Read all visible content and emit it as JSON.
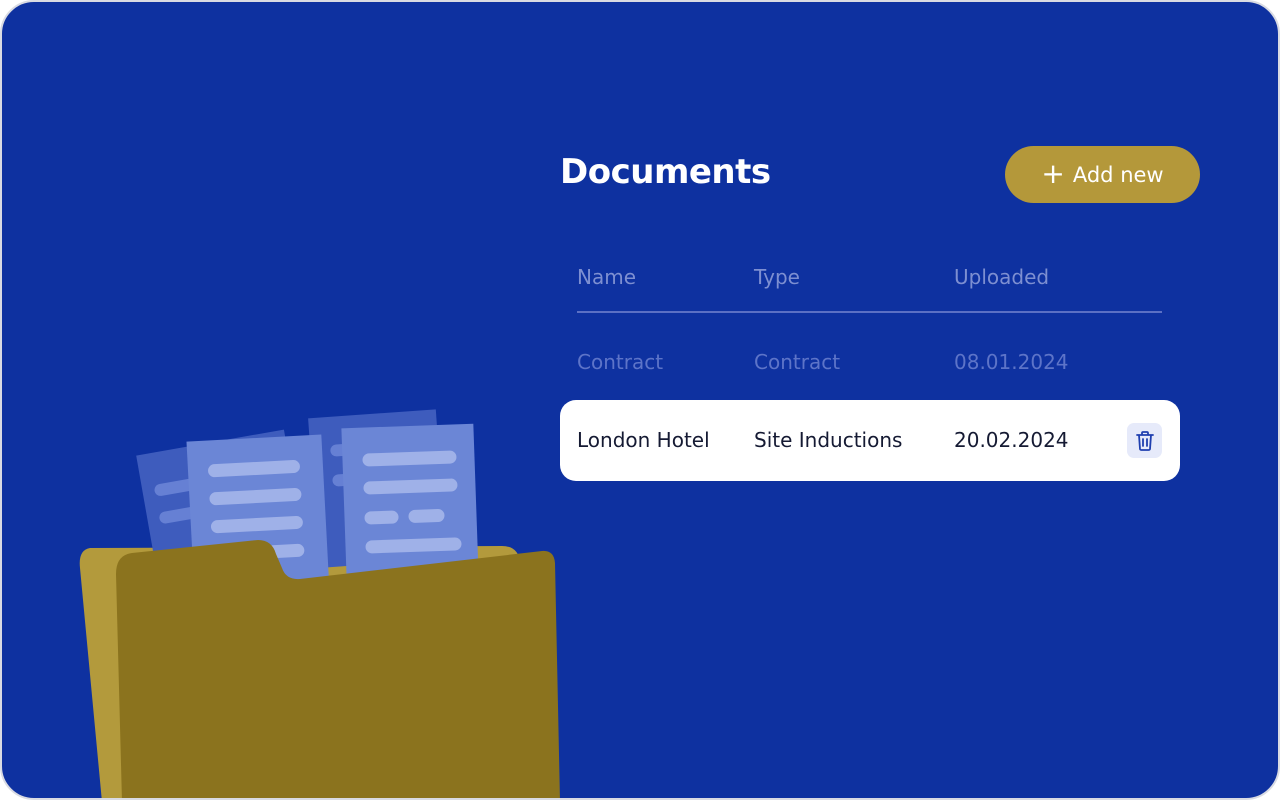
{
  "header": {
    "title": "Documents",
    "add_button": {
      "icon": "plus-icon",
      "label": "Add new"
    }
  },
  "table": {
    "columns": [
      "Name",
      "Type",
      "Uploaded"
    ],
    "rows": [
      {
        "name": "Contract",
        "type": "Contract",
        "uploaded": "08.01.2024",
        "highlighted": false
      },
      {
        "name": "London Hotel",
        "type": "Site Inductions",
        "uploaded": "20.02.2024",
        "highlighted": true,
        "action_icon": "trash-icon"
      }
    ]
  },
  "illustration": {
    "icon": "folder-with-documents-icon"
  },
  "colors": {
    "background": "#0e31a0",
    "accent": "#b4983a",
    "folder_front": "#8b731e",
    "folder_back": "#b39a3c",
    "paper": "#6b86d6"
  }
}
